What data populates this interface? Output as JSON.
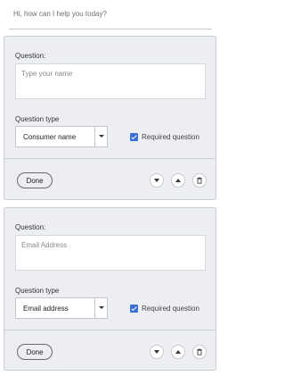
{
  "greeting": "Hi, how can I help you today?",
  "cards": [
    {
      "question_label": "Question:",
      "question_placeholder": "Type your name",
      "type_label": "Question type",
      "type_value": "Consumer name",
      "required_label": "Required question",
      "required_checked": true,
      "done_label": "Done"
    },
    {
      "question_label": "Question:",
      "question_placeholder": "Email Address",
      "type_label": "Question type",
      "type_value": "Email address",
      "required_label": "Required question",
      "required_checked": true,
      "done_label": "Done"
    }
  ],
  "icons": [
    "move-down-icon",
    "move-up-icon",
    "delete-icon"
  ],
  "colors": {
    "card_bg": "#eceef2",
    "checkbox": "#3b6fd8"
  }
}
